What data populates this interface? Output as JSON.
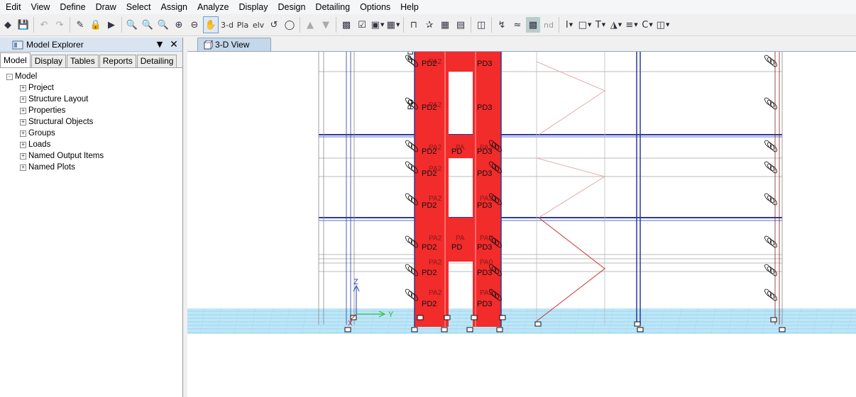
{
  "menu": [
    "Edit",
    "View",
    "Define",
    "Draw",
    "Select",
    "Assign",
    "Analyze",
    "Display",
    "Design",
    "Detailing",
    "Options",
    "Help"
  ],
  "toolbar": {
    "view_3d": "3-d",
    "view_plan": "Pla",
    "view_elev": "elv",
    "nd": "nd"
  },
  "explorer": {
    "title": "Model Explorer",
    "tabs": [
      "Model",
      "Display",
      "Tables",
      "Reports",
      "Detailing"
    ],
    "root": "Model",
    "items": [
      "Project",
      "Structure Layout",
      "Properties",
      "Structural Objects",
      "Groups",
      "Loads",
      "Named Output Items",
      "Named Plots"
    ]
  },
  "view_tab": "3-D View",
  "axis": {
    "z": "Z",
    "y": "Y",
    "x": "X"
  },
  "labels": {
    "pd2": "PD2",
    "pd3": "PD3",
    "pd": "PD",
    "pa2": "PA2",
    "pa3": "PA3",
    "pa": "PA",
    "pa0": "PA0",
    "pd_short": "PD"
  },
  "colors": {
    "wall": "#f22b2b",
    "grid": "#1f2f8f",
    "ground": "#aee0f5",
    "brace": "#cc3333"
  }
}
